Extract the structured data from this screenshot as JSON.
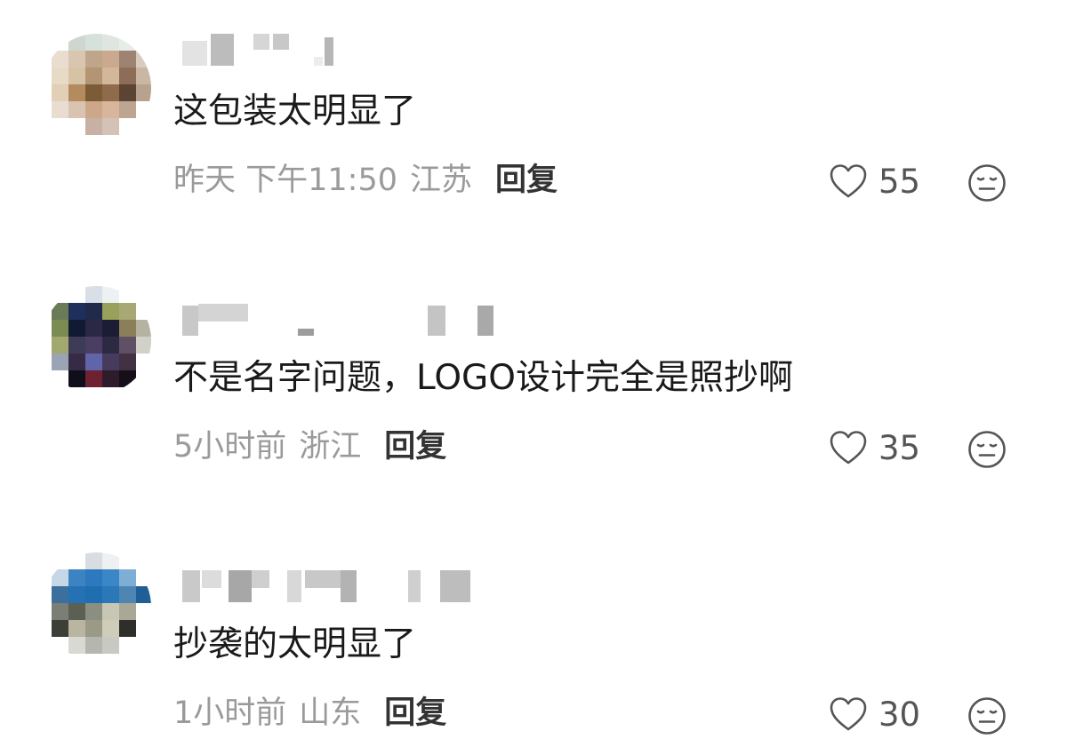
{
  "comments": [
    {
      "text": "这包装太明显了",
      "time": "昨天 下午11:50",
      "location": "江苏",
      "reply_label": "回复",
      "likes": "55",
      "like_icon": "heart-outline-icon",
      "dislike_icon": "meh-face-icon"
    },
    {
      "text": "不是名字问题，LOGO设计完全是照抄啊",
      "time": "5小时前",
      "location": "浙江",
      "reply_label": "回复",
      "likes": "35",
      "like_icon": "heart-outline-icon",
      "dislike_icon": "meh-face-icon"
    },
    {
      "text": "抄袭的太明显了",
      "time": "1小时前",
      "location": "山东",
      "reply_label": "回复",
      "likes": "30",
      "like_icon": "heart-outline-icon",
      "dislike_icon": "meh-face-icon"
    }
  ],
  "colors": {
    "text": "#1a1a1a",
    "meta": "#9a9a9a",
    "reply": "#333333",
    "icon": "#555555"
  }
}
